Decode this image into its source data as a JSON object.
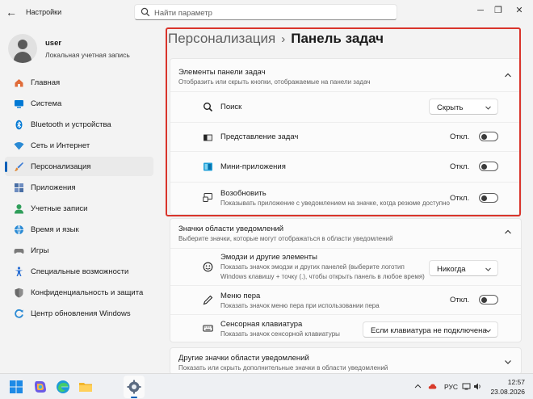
{
  "window": {
    "title": "Настройки",
    "search_placeholder": "Найти параметр",
    "minimize": "─",
    "maximize": "❐",
    "close": "✕",
    "back": "←"
  },
  "user": {
    "name": "user",
    "account_type": "Локальная учетная запись"
  },
  "sidebar": {
    "items": [
      {
        "label": "Главная",
        "icon": "home-icon",
        "color": "#e06c3a"
      },
      {
        "label": "Система",
        "icon": "system-icon",
        "color": "#0078d4"
      },
      {
        "label": "Bluetooth и устройства",
        "icon": "bluetooth-icon",
        "color": "#0078d4"
      },
      {
        "label": "Сеть и Интернет",
        "icon": "wifi-icon",
        "color": "#2a8ad4"
      },
      {
        "label": "Персонализация",
        "icon": "brush-icon",
        "color": "#e08a3a",
        "active": true
      },
      {
        "label": "Приложения",
        "icon": "apps-icon",
        "color": "#4a6fa5"
      },
      {
        "label": "Учетные записи",
        "icon": "accounts-icon",
        "color": "#2f9e5a"
      },
      {
        "label": "Время и язык",
        "icon": "globe-icon",
        "color": "#2a8ad4"
      },
      {
        "label": "Игры",
        "icon": "gamepad-icon",
        "color": "#7a7a7a"
      },
      {
        "label": "Специальные возможности",
        "icon": "accessibility-icon",
        "color": "#2a6fd4"
      },
      {
        "label": "Конфиденциальность и защита",
        "icon": "shield-icon",
        "color": "#6a6a6a"
      },
      {
        "label": "Центр обновления Windows",
        "icon": "update-icon",
        "color": "#2a8ad4"
      }
    ]
  },
  "breadcrumb": {
    "parent": "Персонализация",
    "separator": "›",
    "current": "Панель задач"
  },
  "taskbar_items": {
    "title": "Элементы панели задач",
    "subtitle": "Отобразить или скрыть кнопки, отображаемые на панели задач",
    "rows": [
      {
        "title": "Поиск",
        "icon": "search-icon",
        "control": "dropdown",
        "value": "Скрыть"
      },
      {
        "title": "Представление задач",
        "icon": "task-view-icon",
        "control": "toggle",
        "state": "Откл."
      },
      {
        "title": "Мини-приложения",
        "icon": "widgets-icon",
        "control": "toggle",
        "state": "Откл."
      },
      {
        "title": "Возобновить",
        "subtitle": "Показывать приложение с уведомлением на значке, когда резюме доступно",
        "icon": "resume-icon",
        "control": "toggle",
        "state": "Откл."
      }
    ]
  },
  "tray_icons": {
    "title": "Значки области уведомлений",
    "subtitle": "Выберите значки, которые могут отображаться в области уведомлений",
    "rows": [
      {
        "title": "Эмодзи и другие элементы",
        "subtitle_line1": "Показать значок эмодзи и других панелей (выберите логотип",
        "subtitle_line2": "Windows клавишу + точку (.), чтобы открыть панель в любое время)",
        "icon": "emoji-icon",
        "control": "dropdown",
        "value": "Никогда"
      },
      {
        "title": "Меню пера",
        "subtitle": "Показать значок меню пера при использовании пера",
        "icon": "pen-icon",
        "control": "toggle",
        "state": "Откл."
      },
      {
        "title": "Сенсорная клавиатура",
        "subtitle": "Показать значок сенсорной клавиатуры",
        "icon": "keyboard-icon",
        "control": "dropdown",
        "value": "Если клавиатура не подключена"
      }
    ]
  },
  "other_tray": {
    "title": "Другие значки области уведомлений",
    "subtitle": "Показать или скрыть дополнительные значки в области уведомлений"
  },
  "taskbar": {
    "apps": [
      "windows-start-icon",
      "copilot-icon",
      "edge-icon",
      "explorer-icon",
      "settings-icon"
    ],
    "language": "РУС",
    "time": "12:57",
    "date": "23.08.2026"
  },
  "colors": {
    "accent": "#005fb8",
    "highlight": "#d9342b"
  }
}
